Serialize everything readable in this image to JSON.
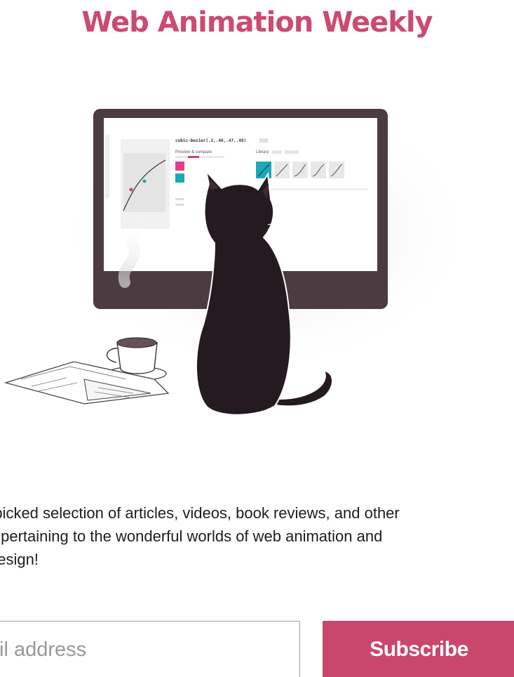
{
  "brand": {
    "title": "Web Animation Weekly",
    "accent_color": "#cc4a72"
  },
  "illustration": {
    "screen_code_text": "cubic-bezier(.2,.46,.47,.48)",
    "preview_label": "Preview & compare",
    "library_label": "Library"
  },
  "blurb": {
    "line1": "-picked selection of articles, videos, book reviews, and other",
    "line2": "s pertaining to the wonderful worlds of web animation and",
    "line3": "design!"
  },
  "signup": {
    "email_placeholder": "il address",
    "subscribe_label": "Subscribe",
    "button_color": "#c9466d"
  }
}
